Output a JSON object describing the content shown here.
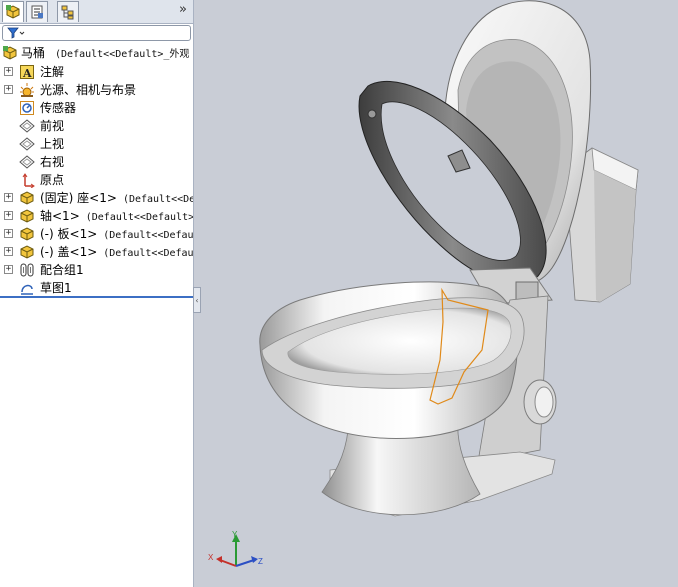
{
  "tabs": [
    {
      "name": "feature-manager",
      "icon": "feature-tree-icon"
    },
    {
      "name": "property-manager",
      "icon": "property-icon"
    },
    {
      "name": "configuration-manager",
      "icon": "configuration-icon"
    }
  ],
  "expand_arrow": "»",
  "tree": {
    "root": {
      "label": "马桶",
      "config": "(Default<<Default>_外观"
    },
    "items": [
      {
        "label": "注解",
        "config": "",
        "icon": "annotation-icon",
        "expandable": true
      },
      {
        "label": "光源、相机与布景",
        "config": "",
        "icon": "lights-camera-icon",
        "expandable": true
      },
      {
        "label": "传感器",
        "config": "",
        "icon": "sensor-icon",
        "expandable": false
      },
      {
        "label": "前视",
        "config": "",
        "icon": "plane-icon",
        "expandable": false
      },
      {
        "label": "上视",
        "config": "",
        "icon": "plane-icon",
        "expandable": false
      },
      {
        "label": "右视",
        "config": "",
        "icon": "plane-icon",
        "expandable": false
      },
      {
        "label": "原点",
        "config": "",
        "icon": "origin-icon",
        "expandable": false
      },
      {
        "label": "(固定) 座<1>",
        "config": "(Default<<De",
        "icon": "part-icon",
        "expandable": true
      },
      {
        "label": "轴<1>",
        "config": "(Default<<Default>_9",
        "icon": "part-icon",
        "expandable": true
      },
      {
        "label": "(-) 板<1>",
        "config": "(Default<<Defau",
        "icon": "part-icon",
        "expandable": true
      },
      {
        "label": "(-) 盖<1>",
        "config": "(Default<<Defau",
        "icon": "part-icon",
        "expandable": true
      },
      {
        "label": "配合组1",
        "config": "",
        "icon": "mates-icon",
        "expandable": true
      },
      {
        "label": "草图1",
        "config": "",
        "icon": "sketch-icon",
        "expandable": false
      }
    ]
  },
  "colors": {
    "viewport_bg": "#c9cdd6",
    "selection_line": "#3c6fc4",
    "sketch": "#e08a1a"
  },
  "triad": {
    "x": "X",
    "y": "Y",
    "z": "Z"
  }
}
